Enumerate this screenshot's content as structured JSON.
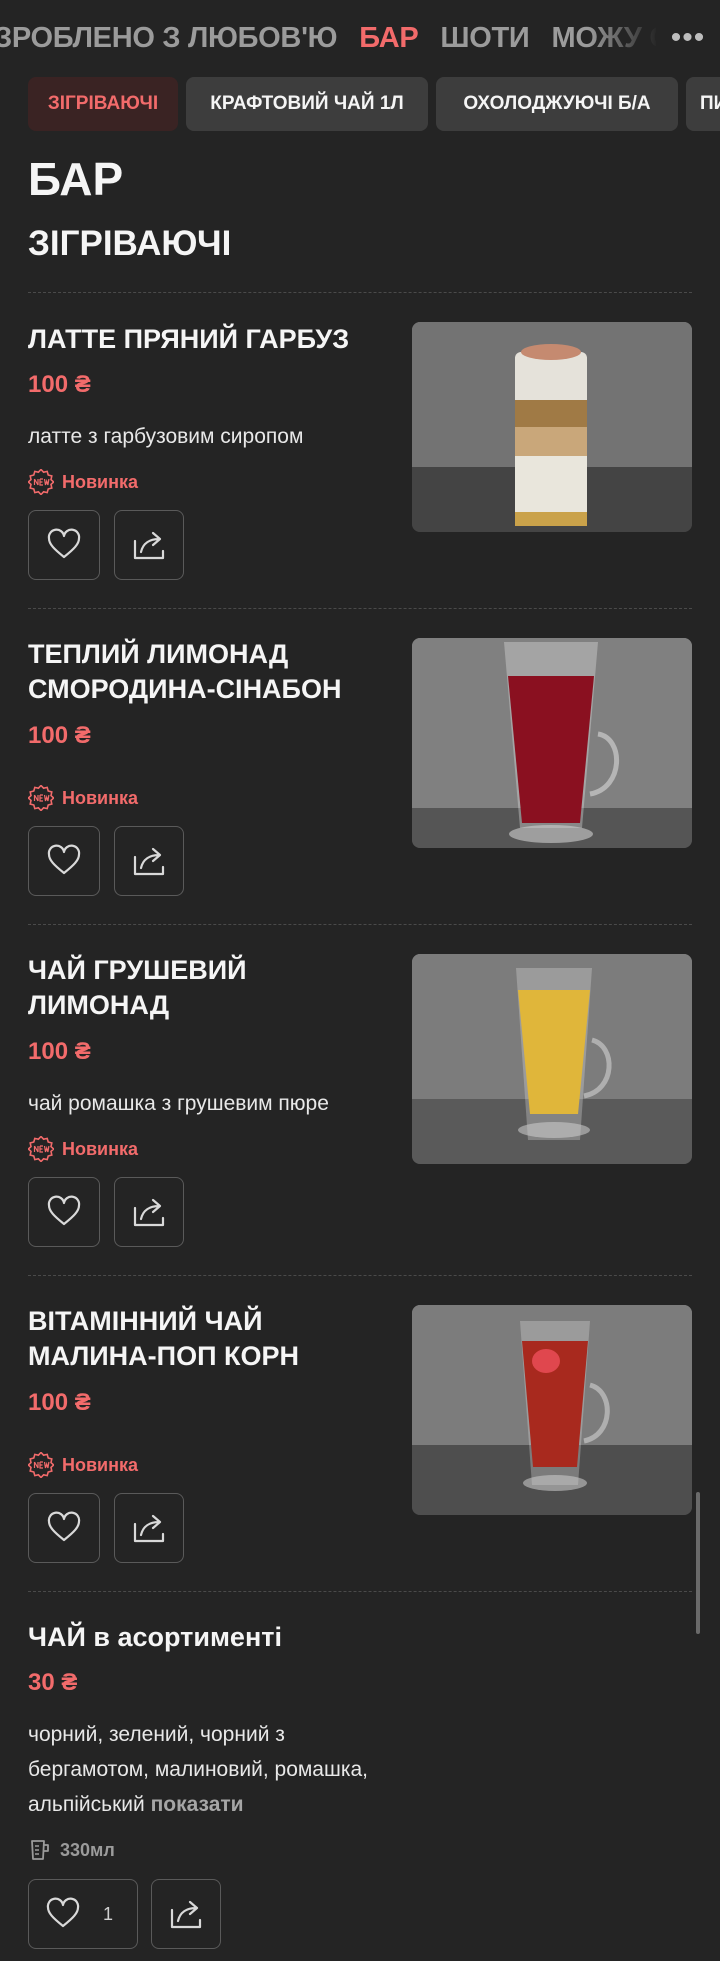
{
  "nav": {
    "items": [
      "ЗРОБЛЕНО З ЛЮБОВ'Ю",
      "БАР",
      "ШОТИ",
      "МОЖУ СОБІ ДОЗВОЛИТИ"
    ],
    "active_index": 1,
    "more_glyph": "•••"
  },
  "chips": {
    "items": [
      "ЗІГРІВАЮЧІ",
      "КРАФТОВИЙ ЧАЙ 1Л",
      "ОХОЛОДЖУЮЧІ Б/А",
      "ПИВО"
    ],
    "active_index": 0
  },
  "page_title": "БАР",
  "section_title": "ЗІГРІВАЮЧІ",
  "items": [
    {
      "name": "ЛАТТЕ ПРЯНИЙ ГАРБУЗ",
      "price": "100 ₴",
      "description": "латте з гарбузовим сиропом",
      "badge": "Новинка",
      "photo_icon": "pumpkin-latte-photo"
    },
    {
      "name": "ТЕПЛИЙ ЛИМОНАД СМОРОДИНА-СІНАБОН",
      "price": "100 ₴",
      "description": "",
      "badge": "Новинка",
      "photo_icon": "currant-lemonade-photo"
    },
    {
      "name": "ЧАЙ ГРУШЕВИЙ ЛИМОНАД",
      "price": "100 ₴",
      "description": "чай ромашка з грушевим пюре",
      "badge": "Новинка",
      "photo_icon": "pear-tea-photo"
    },
    {
      "name": "ВІТАМІННИЙ ЧАЙ МАЛИНА-ПОП КОРН",
      "price": "100 ₴",
      "description": "",
      "badge": "Новинка",
      "photo_icon": "raspberry-tea-photo"
    },
    {
      "name": "ЧАЙ в асортименті",
      "price": "30 ₴",
      "description": "чорний, зелений, чорний з бергамотом, малиновий, ромашка, альпійський",
      "more_label": "показати",
      "volume": "330мл",
      "likes": "1"
    }
  ],
  "colors": {
    "background": "#242424",
    "accent": "#f26b6b",
    "chip": "#3d3d3d",
    "chip_active": "#3a2323"
  },
  "icons": [
    "more-icon",
    "new-badge-icon",
    "heart-icon",
    "share-icon",
    "cup-icon"
  ]
}
